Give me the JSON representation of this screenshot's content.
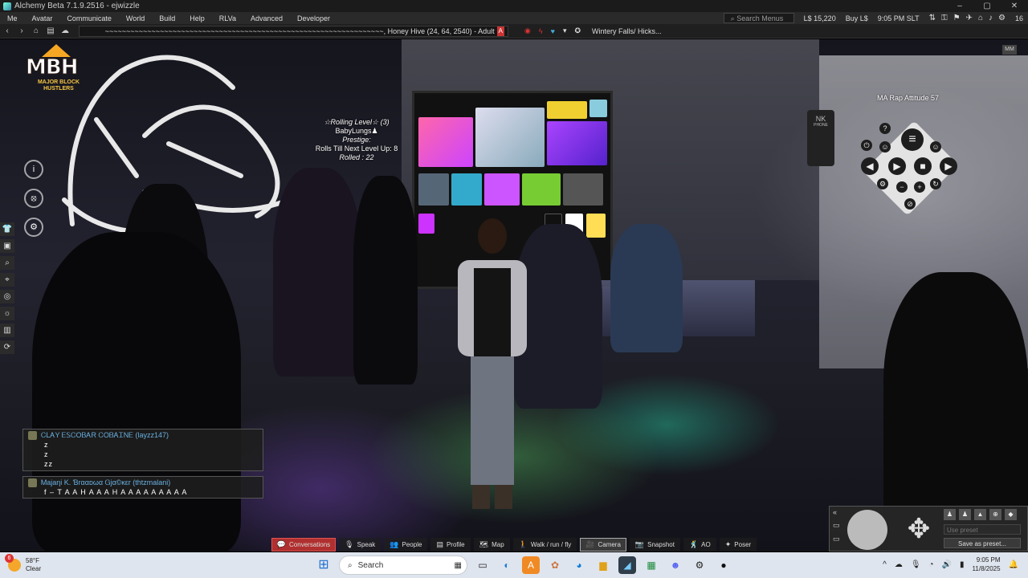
{
  "window": {
    "title": "Alchemy Beta 7.1.9.2516 - ejwizzle",
    "controls": [
      "–",
      "▢",
      "✕"
    ]
  },
  "menu": {
    "items": [
      "Me",
      "Avatar",
      "Communicate",
      "World",
      "Build",
      "Help",
      "RLVa",
      "Advanced",
      "Developer"
    ],
    "search_placeholder": "Search Menus",
    "balance": "L$ 15,220",
    "buy_label": "Buy L$",
    "time": "9:05 PM SLT",
    "fps": "16"
  },
  "navbar": {
    "location": "~~~~~~~~~~~~~~~~~~~~~~~~~~~~~~~~~~~~~~~~~~~~~~~~~~~~~~~~~~~~~~~~~~, Honey Hive (24, 64, 2540) - Adult",
    "rating": "A",
    "favorite": "Wintery Falls/ Hicks..."
  },
  "viewport": {
    "float_text": {
      "line1": "☆Rolling Level☆ (3)",
      "line2": "BabyLungs♟",
      "line3": "Prestige:",
      "line4": "Rolls Till Next Level Up: 8",
      "line5": "Rolled : 22"
    },
    "ma_text": "MA Rap Attitude 57",
    "nk_phone": {
      "brand": "NK",
      "sub": "PHONE"
    },
    "mbh_logo": {
      "main": "MBH",
      "sub": "MAJOR BLOCK HUSTLERS"
    },
    "corner_chip": "MM"
  },
  "chat": [
    {
      "sender": "ᏟLᎪY ᎬᏚᏟOᏴᎪR ᏟOᏴᎪᏆNᎬ (layzz147)",
      "lines": [
        "z",
        "z",
        "zz"
      ]
    },
    {
      "sender": "Ꮇajaηi K. Ɓrααᴅωα Ꮐjα©κεr (thtzmalani)",
      "lines": [
        "f – T A A H A A A H A A A A A A A A A"
      ]
    }
  ],
  "camera_panel": {
    "preset_placeholder": "Use preset",
    "save_preset": "Save as preset..."
  },
  "bottom_toolbar": {
    "conversations": "Conversations",
    "speak": "Speak",
    "people": "People",
    "profile": "Profile",
    "map": "Map",
    "walk": "Walk / run / fly",
    "camera": "Camera",
    "snapshot": "Snapshot",
    "ao": "AO",
    "poser": "Poser"
  },
  "taskbar": {
    "weather_temp": "58°F",
    "weather_desc": "Clear",
    "notification_count": "6",
    "search": "Search",
    "time": "9:05 PM",
    "date": "11/8/2025"
  },
  "colors": {
    "conversations_red": "#b02f2f",
    "chat_sender": "#6ab0e0",
    "taskbar": "#dfe5ee"
  }
}
